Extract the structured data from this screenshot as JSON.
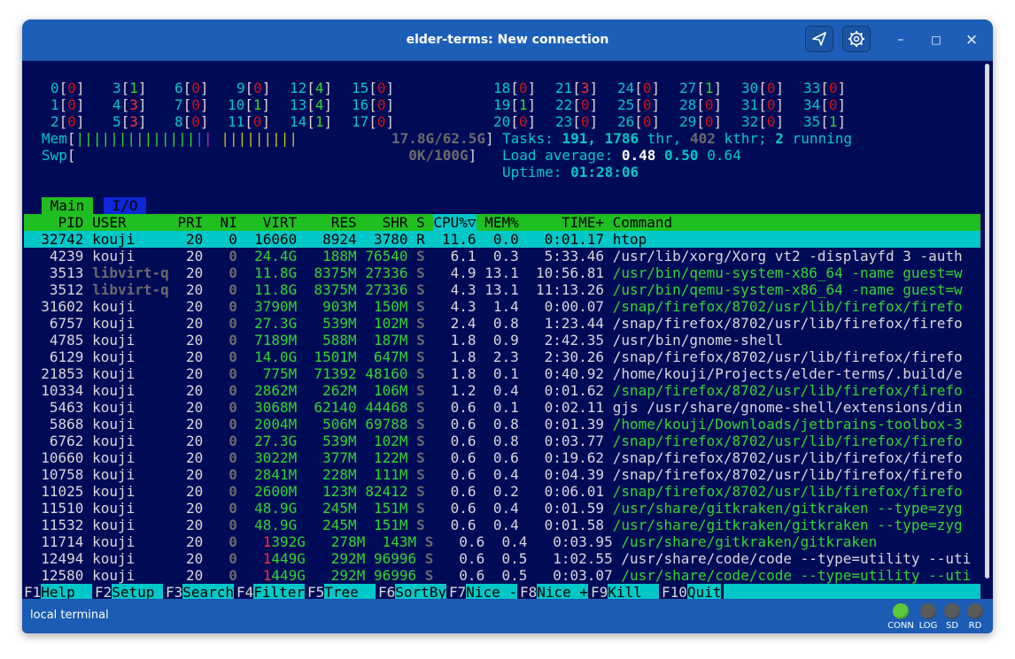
{
  "window": {
    "title": "elder-terms: New connection"
  },
  "titlebar": {
    "send_icon": "paper-plane-icon",
    "settings_icon": "gear-icon",
    "minimize": "–",
    "maximize": "□",
    "close": "×"
  },
  "htop": {
    "cpus_left": [
      [
        "0",
        "0"
      ],
      [
        "1",
        "0"
      ],
      [
        "2",
        "0"
      ],
      [
        "3",
        "1"
      ],
      [
        "4",
        "3"
      ],
      [
        "5",
        "3"
      ],
      [
        "6",
        "0"
      ],
      [
        "7",
        "0"
      ],
      [
        "8",
        "0"
      ],
      [
        "9",
        "0"
      ],
      [
        "10",
        "1"
      ],
      [
        "11",
        "0"
      ],
      [
        "12",
        "4"
      ],
      [
        "13",
        "4"
      ],
      [
        "14",
        "1"
      ],
      [
        "15",
        "0"
      ],
      [
        "16",
        "0"
      ],
      [
        "17",
        "0"
      ]
    ],
    "cpus_right": [
      [
        "18",
        "0"
      ],
      [
        "19",
        "1"
      ],
      [
        "20",
        "0"
      ],
      [
        "21",
        "3"
      ],
      [
        "22",
        "0"
      ],
      [
        "23",
        "0"
      ],
      [
        "24",
        "0"
      ],
      [
        "25",
        "0"
      ],
      [
        "26",
        "0"
      ],
      [
        "27",
        "1"
      ],
      [
        "28",
        "0"
      ],
      [
        "29",
        "0"
      ],
      [
        "30",
        "0"
      ],
      [
        "31",
        "0"
      ],
      [
        "32",
        "0"
      ],
      [
        "33",
        "0"
      ],
      [
        "34",
        "0"
      ],
      [
        "35",
        "1"
      ]
    ],
    "mem": {
      "label": "Mem",
      "value": "17.8G/62.5G"
    },
    "swp": {
      "label": "Swp",
      "value": "0K/100G"
    },
    "tasks": {
      "label": "Tasks:",
      "count": "191",
      "thr": "1786",
      "thr_label": "thr,",
      "kthr": "402",
      "kthr_label": "kthr;",
      "running": "2",
      "running_label": "running"
    },
    "load": {
      "label": "Load average:",
      "v1": "0.48",
      "v2": "0.50",
      "v3": "0.64"
    },
    "uptime": {
      "label": "Uptime:",
      "value": "01:28:06"
    },
    "tabs": [
      "Main",
      "I/O"
    ],
    "columns": [
      "PID",
      "USER",
      "PRI",
      "NI",
      "VIRT",
      "RES",
      "SHR",
      "S",
      "CPU%▽",
      "MEM%",
      "TIME+",
      "Command"
    ],
    "processes": [
      {
        "pid": "32742",
        "user": "kouji",
        "pri": "20",
        "ni": "0",
        "virt": "16060",
        "res": "8924",
        "shr": "3780",
        "s": "R",
        "cpu": "11.6",
        "mem": "0.0",
        "time": "0:01.17",
        "cmd": "htop"
      },
      {
        "pid": "4239",
        "user": "kouji",
        "pri": "20",
        "ni": "0",
        "virt": "24.4G",
        "res": "188M",
        "shr": "76540",
        "s": "S",
        "cpu": "6.1",
        "mem": "0.3",
        "time": "5:33.46",
        "cmd": "/usr/lib/xorg/Xorg vt2 -displayfd 3 -auth"
      },
      {
        "pid": "3513",
        "user": "libvirt-qe",
        "pri": "20",
        "ni": "0",
        "virt": "11.8G",
        "res": "8375M",
        "shr": "27336",
        "s": "S",
        "cpu": "4.9",
        "mem": "13.1",
        "time": "10:56.81",
        "cmd": "/usr/bin/qemu-system-x86_64 -name guest=w"
      },
      {
        "pid": "3512",
        "user": "libvirt-qe",
        "pri": "20",
        "ni": "0",
        "virt": "11.8G",
        "res": "8375M",
        "shr": "27336",
        "s": "S",
        "cpu": "4.3",
        "mem": "13.1",
        "time": "11:13.26",
        "cmd": "/usr/bin/qemu-system-x86_64 -name guest=w"
      },
      {
        "pid": "31602",
        "user": "kouji",
        "pri": "20",
        "ni": "0",
        "virt": "3790M",
        "res": "903M",
        "shr": "150M",
        "s": "S",
        "cpu": "4.3",
        "mem": "1.4",
        "time": "0:00.07",
        "cmd": "/snap/firefox/8702/usr/lib/firefox/firefo"
      },
      {
        "pid": "6757",
        "user": "kouji",
        "pri": "20",
        "ni": "0",
        "virt": "27.3G",
        "res": "539M",
        "shr": "102M",
        "s": "S",
        "cpu": "2.4",
        "mem": "0.8",
        "time": "1:23.44",
        "cmd": "/snap/firefox/8702/usr/lib/firefox/firefo"
      },
      {
        "pid": "4785",
        "user": "kouji",
        "pri": "20",
        "ni": "0",
        "virt": "7189M",
        "res": "588M",
        "shr": "187M",
        "s": "S",
        "cpu": "1.8",
        "mem": "0.9",
        "time": "2:42.35",
        "cmd": "/usr/bin/gnome-shell"
      },
      {
        "pid": "6129",
        "user": "kouji",
        "pri": "20",
        "ni": "0",
        "virt": "14.0G",
        "res": "1501M",
        "shr": "647M",
        "s": "S",
        "cpu": "1.8",
        "mem": "2.3",
        "time": "2:30.26",
        "cmd": "/snap/firefox/8702/usr/lib/firefox/firefo"
      },
      {
        "pid": "21853",
        "user": "kouji",
        "pri": "20",
        "ni": "0",
        "virt": "775M",
        "res": "71392",
        "shr": "48160",
        "s": "S",
        "cpu": "1.8",
        "mem": "0.1",
        "time": "0:40.92",
        "cmd": "/home/kouji/Projects/elder-terms/.build/e"
      },
      {
        "pid": "10334",
        "user": "kouji",
        "pri": "20",
        "ni": "0",
        "virt": "2862M",
        "res": "262M",
        "shr": "106M",
        "s": "S",
        "cpu": "1.2",
        "mem": "0.4",
        "time": "0:01.62",
        "cmd": "/snap/firefox/8702/usr/lib/firefox/firefo"
      },
      {
        "pid": "5463",
        "user": "kouji",
        "pri": "20",
        "ni": "0",
        "virt": "3068M",
        "res": "62140",
        "shr": "44468",
        "s": "S",
        "cpu": "0.6",
        "mem": "0.1",
        "time": "0:02.11",
        "cmd": "gjs /usr/share/gnome-shell/extensions/din"
      },
      {
        "pid": "5868",
        "user": "kouji",
        "pri": "20",
        "ni": "0",
        "virt": "2004M",
        "res": "506M",
        "shr": "69788",
        "s": "S",
        "cpu": "0.6",
        "mem": "0.8",
        "time": "0:01.39",
        "cmd": "/home/kouji/Downloads/jetbrains-toolbox-3"
      },
      {
        "pid": "6762",
        "user": "kouji",
        "pri": "20",
        "ni": "0",
        "virt": "27.3G",
        "res": "539M",
        "shr": "102M",
        "s": "S",
        "cpu": "0.6",
        "mem": "0.8",
        "time": "0:03.77",
        "cmd": "/snap/firefox/8702/usr/lib/firefox/firefo"
      },
      {
        "pid": "10660",
        "user": "kouji",
        "pri": "20",
        "ni": "0",
        "virt": "3022M",
        "res": "377M",
        "shr": "122M",
        "s": "S",
        "cpu": "0.6",
        "mem": "0.6",
        "time": "0:19.62",
        "cmd": "/snap/firefox/8702/usr/lib/firefox/firefo"
      },
      {
        "pid": "10758",
        "user": "kouji",
        "pri": "20",
        "ni": "0",
        "virt": "2841M",
        "res": "228M",
        "shr": "111M",
        "s": "S",
        "cpu": "0.6",
        "mem": "0.4",
        "time": "0:04.39",
        "cmd": "/snap/firefox/8702/usr/lib/firefox/firefo"
      },
      {
        "pid": "11025",
        "user": "kouji",
        "pri": "20",
        "ni": "0",
        "virt": "2600M",
        "res": "123M",
        "shr": "82412",
        "s": "S",
        "cpu": "0.6",
        "mem": "0.2",
        "time": "0:06.01",
        "cmd": "/snap/firefox/8702/usr/lib/firefox/firefo"
      },
      {
        "pid": "11510",
        "user": "kouji",
        "pri": "20",
        "ni": "0",
        "virt": "48.9G",
        "res": "245M",
        "shr": "151M",
        "s": "S",
        "cpu": "0.6",
        "mem": "0.4",
        "time": "0:01.59",
        "cmd": "/usr/share/gitkraken/gitkraken --type=zyg"
      },
      {
        "pid": "11532",
        "user": "kouji",
        "pri": "20",
        "ni": "0",
        "virt": "48.9G",
        "res": "245M",
        "shr": "151M",
        "s": "S",
        "cpu": "0.6",
        "mem": "0.4",
        "time": "0:01.58",
        "cmd": "/usr/share/gitkraken/gitkraken --type=zyg"
      },
      {
        "pid": "11714",
        "user": "kouji",
        "pri": "20",
        "ni": "0",
        "virt": "1392G",
        "res": "278M",
        "shr": "143M",
        "s": "S",
        "cpu": "0.6",
        "mem": "0.4",
        "time": "0:03.95",
        "cmd": "/usr/share/gitkraken/gitkraken"
      },
      {
        "pid": "12494",
        "user": "kouji",
        "pri": "20",
        "ni": "0",
        "virt": "1449G",
        "res": "292M",
        "shr": "96996",
        "s": "S",
        "cpu": "0.6",
        "mem": "0.5",
        "time": "1:02.55",
        "cmd": "/usr/share/code/code --type=utility --uti"
      },
      {
        "pid": "12580",
        "user": "kouji",
        "pri": "20",
        "ni": "0",
        "virt": "1449G",
        "res": "292M",
        "shr": "96996",
        "s": "S",
        "cpu": "0.6",
        "mem": "0.5",
        "time": "0:03.07",
        "cmd": "/usr/share/code/code --type=utility --uti"
      }
    ],
    "fkeys": [
      {
        "key": "F1",
        "label": "Help  "
      },
      {
        "key": "F2",
        "label": "Setup "
      },
      {
        "key": "F3",
        "label": "Search"
      },
      {
        "key": "F4",
        "label": "Filter"
      },
      {
        "key": "F5",
        "label": "Tree  "
      },
      {
        "key": "F6",
        "label": "SortBy"
      },
      {
        "key": "F7",
        "label": "Nice -"
      },
      {
        "key": "F8",
        "label": "Nice +"
      },
      {
        "key": "F9",
        "label": "Kill  "
      },
      {
        "key": "F10",
        "label": "Quit"
      }
    ]
  },
  "statusbar": {
    "text": "local terminal",
    "indicators": [
      {
        "label": "CONN",
        "color": "#5ec83a"
      },
      {
        "label": "LOG",
        "color": "#5a5a5a"
      },
      {
        "label": "SD",
        "color": "#5a5a5a"
      },
      {
        "label": "RD",
        "color": "#5a5a5a"
      }
    ]
  }
}
